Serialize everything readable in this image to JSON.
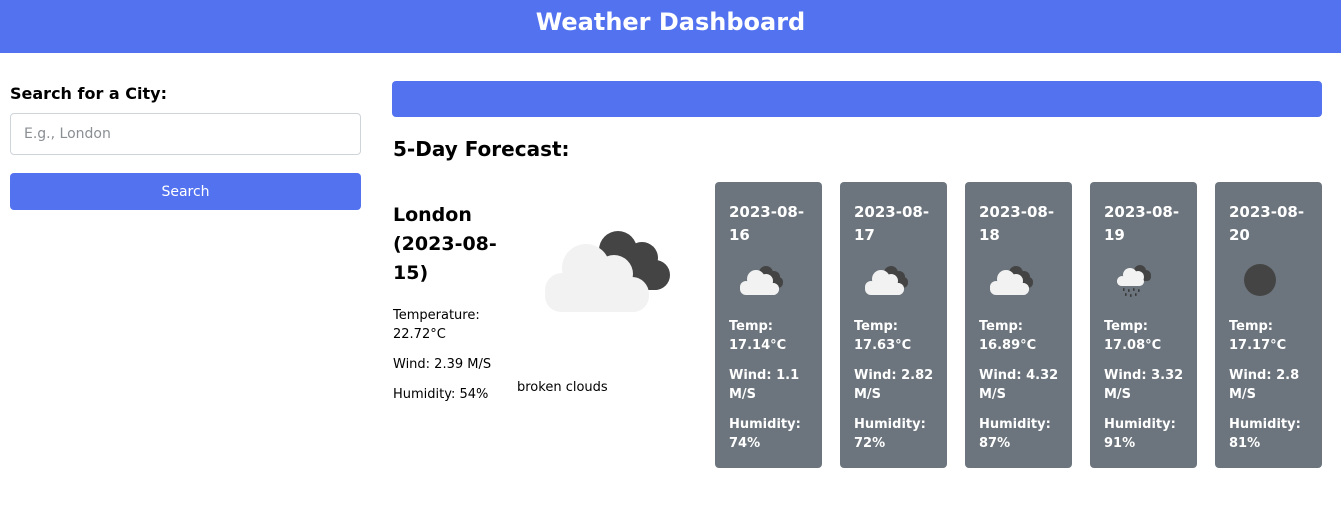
{
  "header": {
    "title": "Weather Dashboard"
  },
  "search": {
    "label": "Search for a City:",
    "placeholder": "E.g., London",
    "value": "",
    "button_label": "Search"
  },
  "forecast_heading": "5-Day Forecast:",
  "today": {
    "title": "London (2023-08-15)",
    "temperature": "Temperature: 22.72°C",
    "wind": "Wind: 2.39 M/S",
    "humidity": "Humidity: 54%",
    "description": "broken clouds",
    "icon": "broken-clouds-icon"
  },
  "forecast": [
    {
      "date": "2023-08-16",
      "icon": "broken-clouds-icon",
      "temp": "Temp: 17.14°C",
      "wind": "Wind: 1.1 M/S",
      "humidity": "Humidity: 74%"
    },
    {
      "date": "2023-08-17",
      "icon": "broken-clouds-icon",
      "temp": "Temp: 17.63°C",
      "wind": "Wind: 2.82 M/S",
      "humidity": "Humidity: 72%"
    },
    {
      "date": "2023-08-18",
      "icon": "broken-clouds-icon",
      "temp": "Temp: 16.89°C",
      "wind": "Wind: 4.32 M/S",
      "humidity": "Humidity: 87%"
    },
    {
      "date": "2023-08-19",
      "icon": "rain-icon",
      "temp": "Temp: 17.08°C",
      "wind": "Wind: 3.32 M/S",
      "humidity": "Humidity: 91%"
    },
    {
      "date": "2023-08-20",
      "icon": "overcast-clouds-icon",
      "temp": "Temp: 17.17°C",
      "wind": "Wind: 2.8 M/S",
      "humidity": "Humidity: 81%"
    }
  ],
  "colors": {
    "primary": "#5372ef",
    "card_background": "#6c757d",
    "text_light": "#ffffff"
  }
}
